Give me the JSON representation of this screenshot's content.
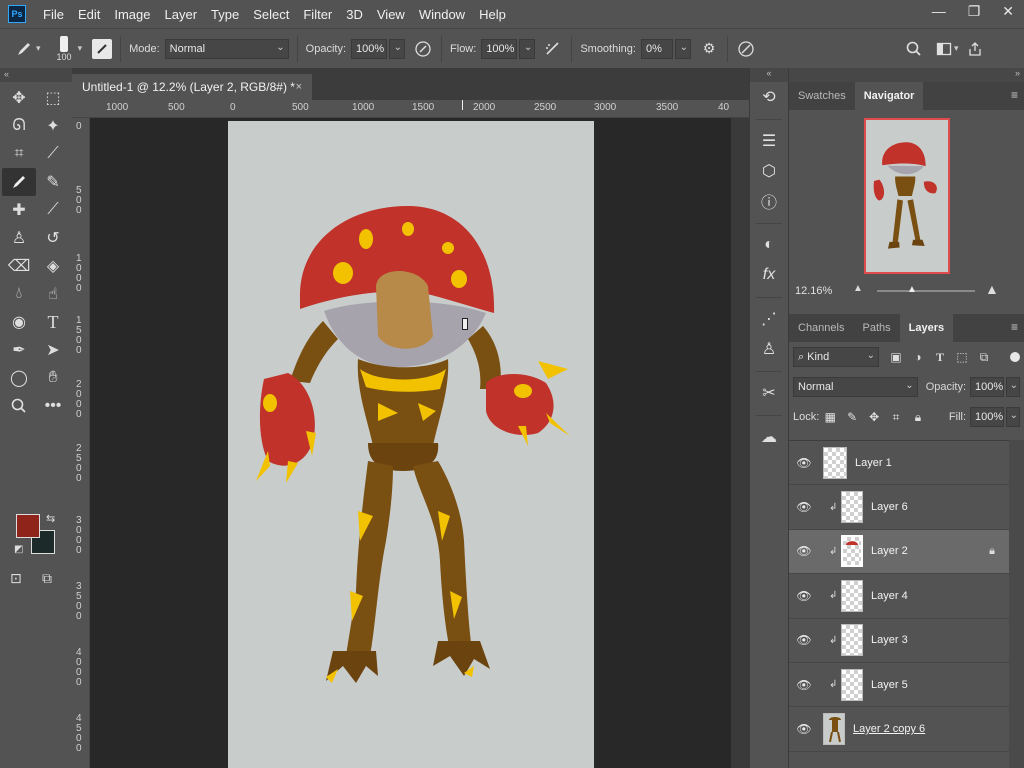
{
  "menubar": {
    "logo": "Ps",
    "items": [
      "File",
      "Edit",
      "Image",
      "Layer",
      "Type",
      "Select",
      "Filter",
      "3D",
      "View",
      "Window",
      "Help"
    ],
    "window_controls": [
      "—",
      "❐",
      "✕"
    ]
  },
  "options": {
    "brush_size": "100",
    "mode_label": "Mode:",
    "mode_value": "Normal",
    "opacity_label": "Opacity:",
    "opacity_value": "100%",
    "flow_label": "Flow:",
    "flow_value": "100%",
    "smoothing_label": "Smoothing:",
    "smoothing_value": "0%"
  },
  "document": {
    "tab_title": "Untitled-1 @ 12.2% (Layer 2, RGB/8#) *",
    "close": "×"
  },
  "rulers": {
    "horizontal": [
      "1000",
      "500",
      "0",
      "500",
      "1000",
      "1500",
      "2000",
      "2500",
      "3000",
      "3500",
      "40"
    ],
    "vertical": [
      "0",
      "5\n0\n0",
      "1\n0\n0\n0",
      "1\n5\n0\n0",
      "2\n0\n0\n0",
      "2\n5\n0\n0",
      "3\n0\n0\n0",
      "3\n5\n0\n0",
      "4\n0\n0\n0",
      "4\n5\n0\n0"
    ]
  },
  "colors": {
    "foreground": "#8f241b",
    "background": "#1d2a2a",
    "mushroom_cap": "#c0322a",
    "spots": "#f2c200",
    "body": "#7a4f12"
  },
  "navigator": {
    "tabs": [
      "Swatches",
      "Navigator"
    ],
    "active_tab": "Navigator",
    "zoom": "12.16%"
  },
  "layers_panel": {
    "tabs": [
      "Channels",
      "Paths",
      "Layers"
    ],
    "active_tab": "Layers",
    "filter_label": "Kind",
    "blend_mode": "Normal",
    "opacity_label": "Opacity:",
    "opacity_value": "100%",
    "lock_label": "Lock:",
    "fill_label": "Fill:",
    "fill_value": "100%",
    "layers": [
      {
        "name": "Layer 1",
        "clipped": false,
        "selected": false,
        "locked": false
      },
      {
        "name": "Layer 6",
        "clipped": true,
        "selected": false,
        "locked": false
      },
      {
        "name": "Layer 2",
        "clipped": true,
        "selected": true,
        "locked": true
      },
      {
        "name": "Layer 4",
        "clipped": true,
        "selected": false,
        "locked": false
      },
      {
        "name": "Layer 3",
        "clipped": true,
        "selected": false,
        "locked": false
      },
      {
        "name": "Layer 5",
        "clipped": true,
        "selected": false,
        "locked": false
      },
      {
        "name": "Layer 2 copy 6",
        "clipped": false,
        "selected": false,
        "locked": false
      }
    ]
  }
}
